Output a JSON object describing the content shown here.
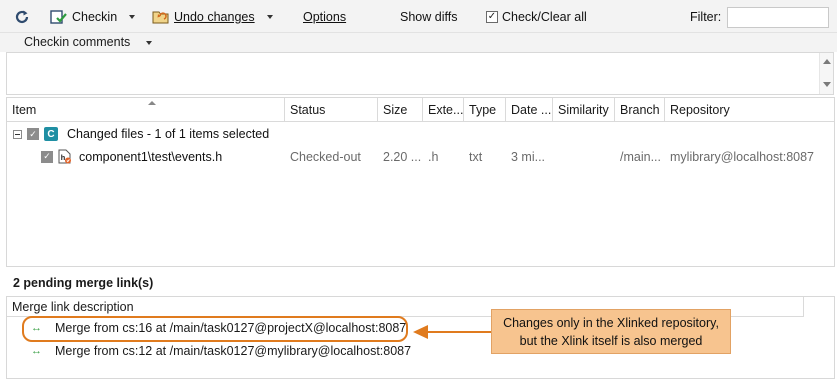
{
  "toolbar": {
    "checkin_label": "Checkin",
    "undo_label": "Undo changes",
    "options_label": "Options",
    "show_diffs_label": "Show diffs",
    "check_clear_label": "Check/Clear all",
    "check_clear_checked": true,
    "filter_label": "Filter:",
    "filter_value": ""
  },
  "comments": {
    "label": "Checkin comments",
    "value": ""
  },
  "grid": {
    "columns": [
      "Item",
      "Status",
      "Size",
      "Exte...",
      "Type",
      "Date ...",
      "Similarity",
      "Branch",
      "Repository"
    ],
    "group": {
      "label": "Changed files - 1 of 1 items selected",
      "icon": "C"
    },
    "rows": [
      {
        "item": "component1\\test\\events.h",
        "status": "Checked-out",
        "size": "2.20 ...",
        "ext": ".h",
        "type": "txt",
        "date": "3 mi...",
        "similarity": "",
        "branch": "/main...",
        "repository": "mylibrary@localhost:8087"
      }
    ]
  },
  "merge": {
    "title": "2 pending merge link(s)",
    "header": "Merge link description",
    "links": [
      {
        "text": "Merge  from  cs:16 at /main/task0127@projectX@localhost:8087"
      },
      {
        "text": "Merge  from  cs:12 at /main/task0127@mylibrary@localhost:8087"
      }
    ]
  },
  "callout": {
    "line1": "Changes only in the Xlinked repository,",
    "line2": "but the Xlink itself is also merged"
  },
  "colors": {
    "highlight": "#e07b1e",
    "callout_bg": "#f7c48f",
    "accent_icon": "#1f8fa3",
    "merge_arrow": "#3aa046"
  }
}
